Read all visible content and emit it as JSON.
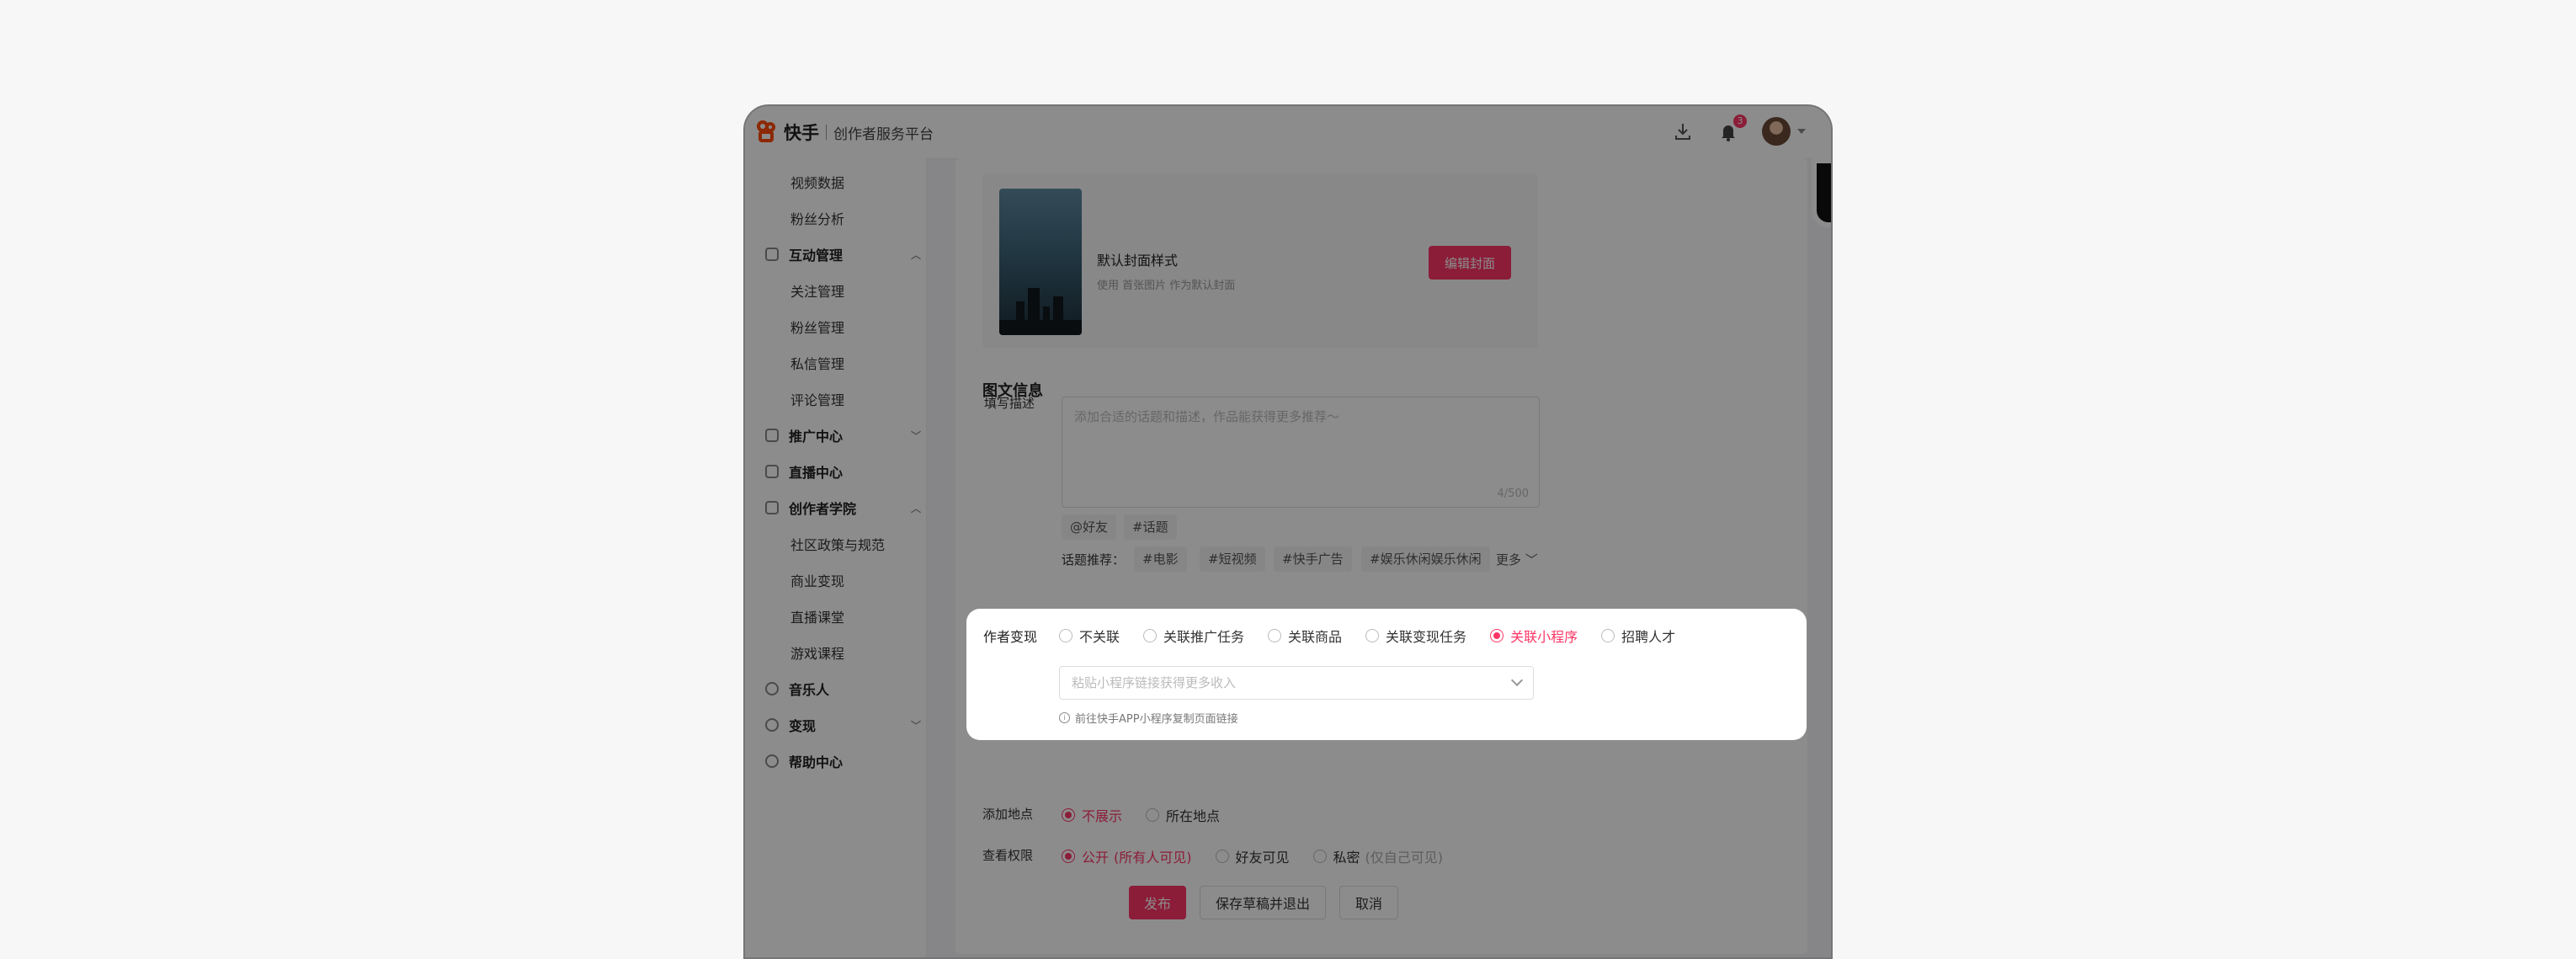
{
  "header": {
    "logo_text": "快手",
    "subtitle": "创作者服务平台",
    "notification_count": "3"
  },
  "sidebar": {
    "items": [
      {
        "label": "视频数据",
        "type": "sub"
      },
      {
        "label": "粉丝分析",
        "type": "sub"
      },
      {
        "label": "互动管理",
        "type": "top",
        "chevron": "up"
      },
      {
        "label": "关注管理",
        "type": "sub"
      },
      {
        "label": "粉丝管理",
        "type": "sub"
      },
      {
        "label": "私信管理",
        "type": "sub"
      },
      {
        "label": "评论管理",
        "type": "sub"
      },
      {
        "label": "推广中心",
        "type": "top",
        "chevron": "down"
      },
      {
        "label": "直播中心",
        "type": "top"
      },
      {
        "label": "创作者学院",
        "type": "top",
        "chevron": "up"
      },
      {
        "label": "社区政策与规范",
        "type": "sub"
      },
      {
        "label": "商业变现",
        "type": "sub"
      },
      {
        "label": "直播课堂",
        "type": "sub"
      },
      {
        "label": "游戏课程",
        "type": "sub"
      },
      {
        "label": "音乐人",
        "type": "top"
      },
      {
        "label": "变现",
        "type": "top",
        "chevron": "down"
      },
      {
        "label": "帮助中心",
        "type": "top"
      }
    ]
  },
  "cover": {
    "title": "默认封面样式",
    "desc": "使用 首张图片 作为默认封面",
    "edit_button": "编辑封面"
  },
  "info": {
    "section_title": "图文信息",
    "desc_label": "填写描述",
    "desc_placeholder": "添加合适的话题和描述，作品能获得更多推荐～",
    "desc_counter": "4/500",
    "mention_chip": "@好友",
    "topic_chip": "#话题",
    "topic_rec_label": "话题推荐：",
    "topic_recs": [
      "#电影",
      "#短视频",
      "#快手广告",
      "#娱乐休闲娱乐休闲"
    ],
    "more_label": "更多"
  },
  "monetize": {
    "label": "作者变现",
    "options": [
      "不关联",
      "关联推广任务",
      "关联商品",
      "关联变现任务",
      "关联小程序",
      "招聘人才"
    ],
    "selected": "关联小程序",
    "select_placeholder": "粘贴小程序链接获得更多收入",
    "tip": "前往快手APP小程序复制页面链接"
  },
  "location": {
    "label": "添加地点",
    "options": [
      "不展示",
      "所在地点"
    ],
    "selected": "不展示"
  },
  "permission": {
    "label": "查看权限",
    "options": [
      {
        "label": "公开",
        "note": "(所有人可见)"
      },
      {
        "label": "好友可见",
        "note": ""
      },
      {
        "label": "私密",
        "note": "(仅自己可见)"
      }
    ],
    "selected": "公开"
  },
  "actions": {
    "publish": "发布",
    "save_draft": "保存草稿并退出",
    "cancel": "取消"
  },
  "colors": {
    "accent": "#fe3666",
    "logo": "#ff4906"
  }
}
